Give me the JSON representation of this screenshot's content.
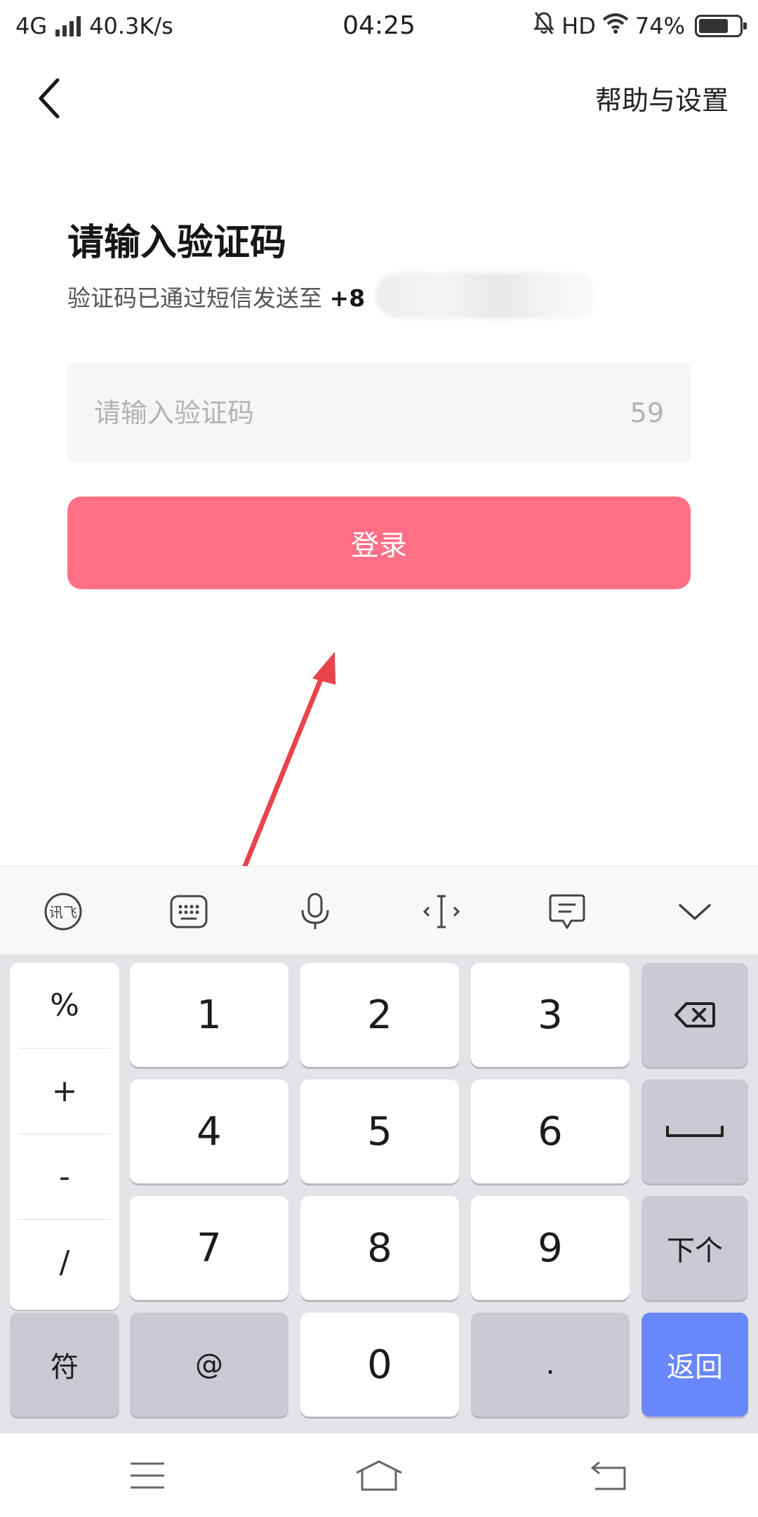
{
  "status_bar": {
    "network": "4G",
    "speed": "40.3K/s",
    "time": "04:25",
    "hd": "HD",
    "battery_text": "74%",
    "battery_level": 0.74
  },
  "header": {
    "back_icon": "chevron-left-icon",
    "help_label": "帮助与设置"
  },
  "main": {
    "title": "请输入验证码",
    "subtitle": "验证码已通过短信发送至",
    "phone_prefix": "+8",
    "code_input": {
      "value": "",
      "placeholder": "请输入验证码"
    },
    "countdown": "59",
    "login_label": "登录",
    "login_color": "#ff7087"
  },
  "keyboard": {
    "toolbar": [
      {
        "icon": "ifly-logo-icon"
      },
      {
        "icon": "keyboard-icon"
      },
      {
        "icon": "microphone-icon"
      },
      {
        "icon": "cursor-move-icon"
      },
      {
        "icon": "clipboard-icon"
      },
      {
        "icon": "collapse-icon"
      }
    ],
    "symbols": [
      "%",
      "+",
      "-",
      "/"
    ],
    "digits": [
      "1",
      "2",
      "3",
      "4",
      "5",
      "6",
      "7",
      "8",
      "9"
    ],
    "backspace_icon": "backspace-icon",
    "space_icon": "space-icon",
    "next_label": "下个",
    "sym_label": "符",
    "at_label": "@",
    "zero_label": "0",
    "dot_label": ".",
    "return_label": "返回",
    "return_color": "#6887fb"
  },
  "nav_bar": {
    "menu_icon": "menu-icon",
    "home_icon": "home-icon",
    "back_icon": "back-icon"
  }
}
